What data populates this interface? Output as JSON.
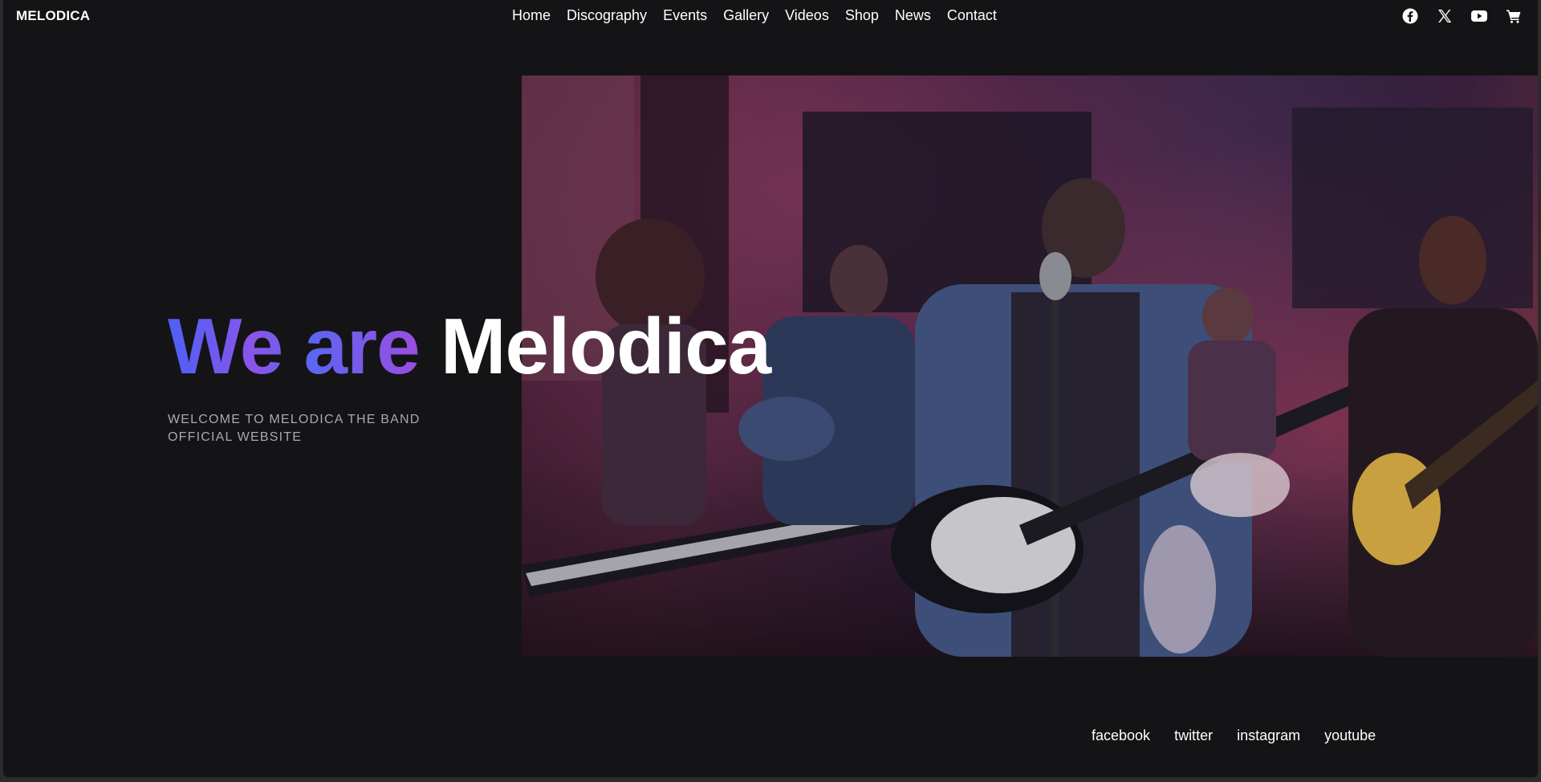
{
  "brand": {
    "logo": "MELODICA"
  },
  "nav": {
    "items": [
      {
        "label": "Home"
      },
      {
        "label": "Discography"
      },
      {
        "label": "Events"
      },
      {
        "label": "Gallery"
      },
      {
        "label": "Videos"
      },
      {
        "label": "Shop"
      },
      {
        "label": "News"
      },
      {
        "label": "Contact"
      }
    ],
    "icons": [
      "facebook-icon",
      "x-icon",
      "youtube-icon",
      "cart-icon"
    ]
  },
  "hero": {
    "headline_part1": "We are",
    "headline_part2": "Melodica",
    "subtitle_line1": "WELCOME TO MELODICA THE BAND",
    "subtitle_line2": "OFFICIAL WEBSITE"
  },
  "footer": {
    "social": [
      {
        "label": "facebook"
      },
      {
        "label": "twitter"
      },
      {
        "label": "instagram"
      },
      {
        "label": "youtube"
      }
    ]
  },
  "colors": {
    "background": "#141417",
    "text": "#ffffff",
    "subtitle": "#a8a8ae",
    "gradient_start": "#4f5ff5",
    "gradient_end": "#9a4ee0"
  }
}
